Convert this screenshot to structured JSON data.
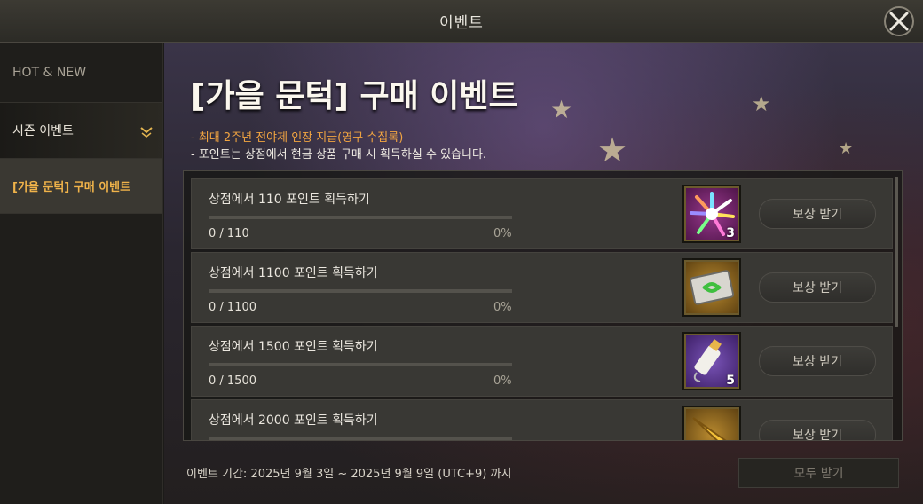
{
  "window": {
    "title": "이벤트",
    "close_icon": "close-icon"
  },
  "sidebar": {
    "items": [
      {
        "label": "HOT & NEW"
      },
      {
        "label": "시즌 이벤트",
        "icon": "chevron-down-icon"
      },
      {
        "label": "[가을 문턱] 구매 이벤트"
      }
    ]
  },
  "event": {
    "title": "[가을 문턱] 구매 이벤트",
    "desc1": "- 최대 2주년 전야제 인장 지급(영구 수집록)",
    "desc2": "- 포인트는 상점에서 현금 상품 구매 시 획득하실 수 있습니다.",
    "period": "이벤트 기간: 2025년 9월 3일 ~ 2025년 9월 9일 (UTC+9) 까지",
    "claim_all_label": "모두 받기"
  },
  "missions": [
    {
      "text": "상점에서 110 포인트 획득하기",
      "progress": "0 / 110",
      "percent": "0%",
      "progress_fraction": 0,
      "reward_icon": "crystal-burst-icon",
      "reward_qty": "3",
      "button_label": "보상 받기"
    },
    {
      "text": "상점에서 1100 포인트 획득하기",
      "progress": "0 / 1100",
      "percent": "0%",
      "progress_fraction": 0,
      "reward_icon": "ticket-icon",
      "reward_qty": "",
      "button_label": "보상 받기"
    },
    {
      "text": "상점에서 1500 포인트 획득하기",
      "progress": "0 / 1500",
      "percent": "0%",
      "progress_fraction": 0,
      "reward_icon": "paint-tube-icon",
      "reward_qty": "5",
      "button_label": "보상 받기"
    },
    {
      "text": "상점에서 2000 포인트 획득하기",
      "progress": "",
      "percent": "",
      "progress_fraction": 0,
      "reward_icon": "golden-blade-icon",
      "reward_qty": "",
      "button_label": "보상 받기"
    }
  ],
  "colors": {
    "accent": "#f0b34a",
    "highlight_text": "#f2a541"
  }
}
